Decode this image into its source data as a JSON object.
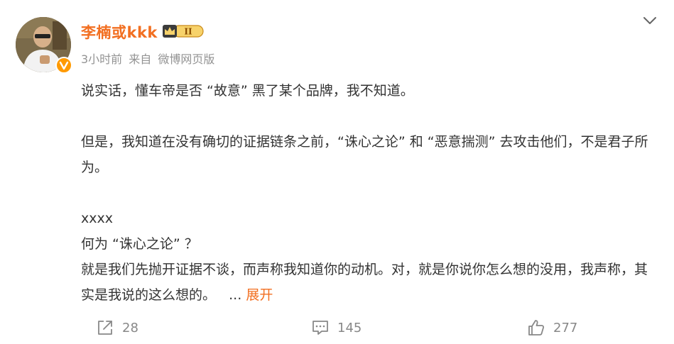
{
  "post": {
    "author": {
      "name": "李楠或kkk",
      "vip_level": "II"
    },
    "meta": {
      "time": "3小时前",
      "source_prefix": "来自",
      "source": "微博网页版"
    },
    "paragraphs": [
      "说实话，懂车帝是否 “故意” 黑了某个品牌，我不知道。",
      "但是，我知道在没有确切的证据链条之前，“诛心之论” 和 “恶意揣测” 去攻击他们，不是君子所为。",
      "xxxx",
      "何为 “诛心之论” ？",
      "就是我们先抛开证据不谈，而声称我知道你的动机。对，就是你说你怎么想的没用，我声称，其实是我说的这么想的。"
    ],
    "expand_ellipsis": "...",
    "expand_label": "展开"
  },
  "actions": {
    "repost_count": "28",
    "comment_count": "145",
    "like_count": "277"
  },
  "colors": {
    "accent": "#f26f21",
    "text": "#333333",
    "muted": "#939393",
    "icon": "#888888",
    "verified": "#ff9a00"
  },
  "icons": {
    "more": "chevron-down-icon",
    "repost": "share-icon",
    "comment": "comment-icon",
    "like": "thumbs-up-icon",
    "verified": "verified-v-icon",
    "vip": "vip-crown-badge-icon"
  }
}
